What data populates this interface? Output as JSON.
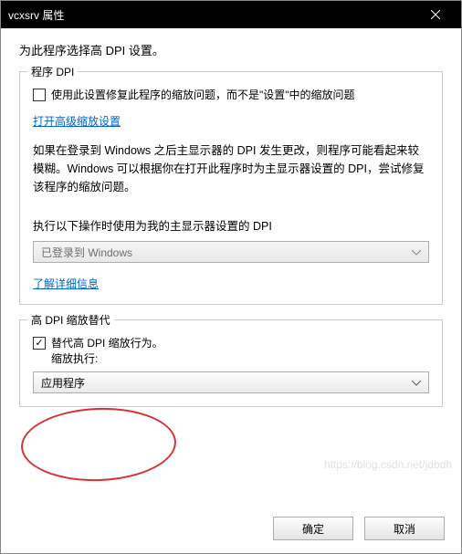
{
  "window": {
    "title": "vcxsrv 属性"
  },
  "intro": "为此程序选择高 DPI 设置。",
  "group1": {
    "legend": "程序 DPI",
    "checkbox_label": "使用此设置修复此程序的缩放问题，而不是\"设置\"中的缩放问题",
    "checkbox_checked": false,
    "link": "打开高级缩放设置",
    "description": "如果在登录到 Windows 之后主显示器的 DPI 发生更改，则程序可能看起来较模糊。Windows 可以根据你在打开此程序时为主显示器设置的 DPI，尝试修复该程序的缩放问题。",
    "sub_label": "执行以下操作时使用为我的主显示器设置的 DPI",
    "combo_value": "已登录到 Windows",
    "link2": "了解详细信息"
  },
  "group2": {
    "legend": "高 DPI 缩放替代",
    "checkbox_label_line1": "替代高 DPI 缩放行为。",
    "checkbox_label_line2": "缩放执行:",
    "checkbox_checked": true,
    "combo_value": "应用程序"
  },
  "buttons": {
    "ok": "确定",
    "cancel": "取消"
  },
  "watermark": "https://blog.csdn.net/jdbdh"
}
